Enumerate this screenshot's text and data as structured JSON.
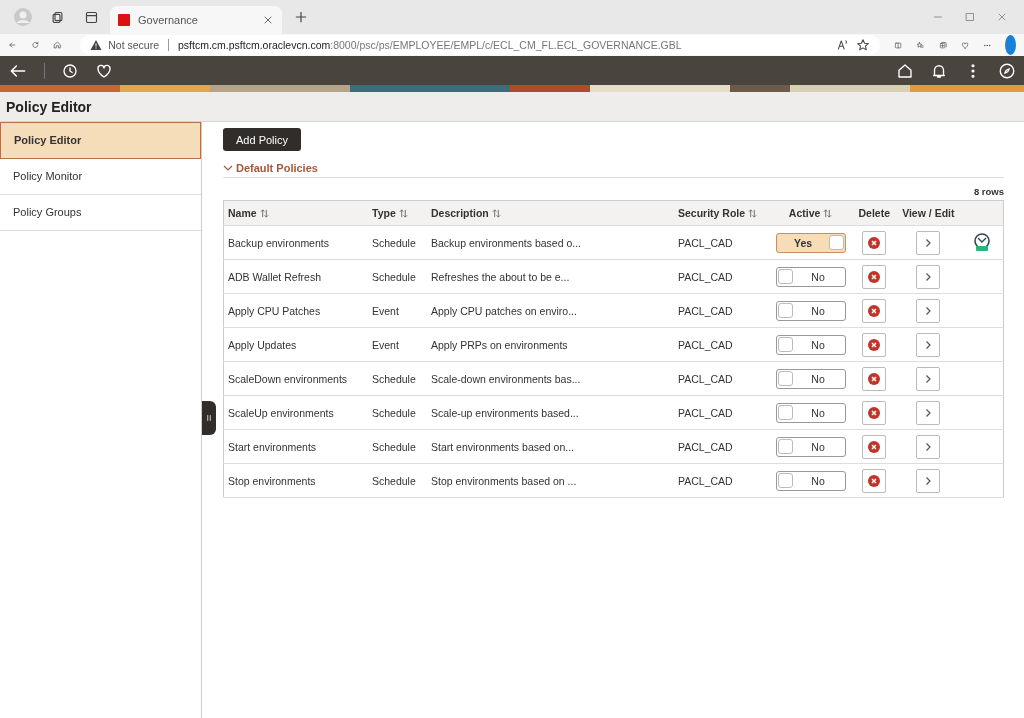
{
  "browser": {
    "tab_title": "Governance",
    "security": "Not secure",
    "url_host": "psftcm.cm.psftcm.oraclevcn.com",
    "url_path": ":8000/psc/ps/EMPLOYEE/EMPL/c/ECL_CM_FL.ECL_GOVERNANCE.GBL"
  },
  "page_title": "Policy Editor",
  "sidebar": {
    "items": [
      {
        "label": "Policy Editor",
        "selected": true
      },
      {
        "label": "Policy Monitor",
        "selected": false
      },
      {
        "label": "Policy Groups",
        "selected": false
      }
    ]
  },
  "add_button": "Add Policy",
  "section": {
    "title": "Default Policies",
    "expanded": true
  },
  "row_count": "8 rows",
  "table": {
    "columns": [
      {
        "label": "Name",
        "sortable": true
      },
      {
        "label": "Type",
        "sortable": true
      },
      {
        "label": "Description",
        "sortable": true
      },
      {
        "label": "Security Role",
        "sortable": true
      },
      {
        "label": "Active",
        "sortable": true
      },
      {
        "label": "Delete",
        "sortable": false
      },
      {
        "label": "View / Edit",
        "sortable": false
      }
    ],
    "rows": [
      {
        "name": "Backup environments",
        "type": "Schedule",
        "description": "Backup environments based o...",
        "role": "PACL_CAD",
        "active": true,
        "active_label": "Yes",
        "scheduled": true
      },
      {
        "name": "ADB Wallet Refresh",
        "type": "Schedule",
        "description": "Refreshes the about to be e...",
        "role": "PACL_CAD",
        "active": false,
        "active_label": "No",
        "scheduled": false
      },
      {
        "name": "Apply CPU Patches",
        "type": "Event",
        "description": "Apply CPU patches on enviro...",
        "role": "PACL_CAD",
        "active": false,
        "active_label": "No",
        "scheduled": false
      },
      {
        "name": "Apply Updates",
        "type": "Event",
        "description": "Apply PRPs on environments",
        "role": "PACL_CAD",
        "active": false,
        "active_label": "No",
        "scheduled": false
      },
      {
        "name": "ScaleDown environments",
        "type": "Schedule",
        "description": "Scale-down environments bas...",
        "role": "PACL_CAD",
        "active": false,
        "active_label": "No",
        "scheduled": false
      },
      {
        "name": "ScaleUp environments",
        "type": "Schedule",
        "description": "Scale-up environments based...",
        "role": "PACL_CAD",
        "active": false,
        "active_label": "No",
        "scheduled": false
      },
      {
        "name": "Start environments",
        "type": "Schedule",
        "description": "Start environments based on...",
        "role": "PACL_CAD",
        "active": false,
        "active_label": "No",
        "scheduled": false
      },
      {
        "name": "Stop environments",
        "type": "Schedule",
        "description": "Stop environments based on ...",
        "role": "PACL_CAD",
        "active": false,
        "active_label": "No",
        "scheduled": false
      }
    ]
  }
}
